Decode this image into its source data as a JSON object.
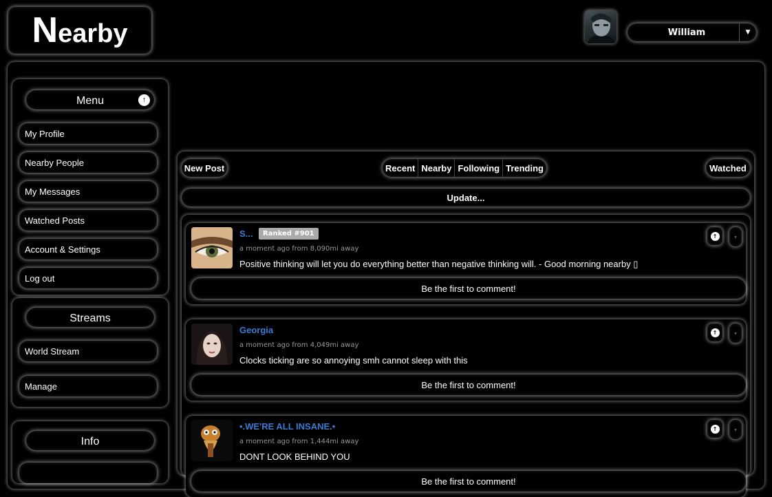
{
  "logo": {
    "initial": "N",
    "rest": "earby"
  },
  "user": {
    "name": "William",
    "caret": "▼"
  },
  "sidebar": {
    "menu": {
      "title": "Menu",
      "items": [
        {
          "label": "My Profile"
        },
        {
          "label": "Nearby People"
        },
        {
          "label": "My Messages"
        },
        {
          "label": "Watched Posts"
        },
        {
          "label": "Account & Settings"
        },
        {
          "label": "Log out"
        }
      ]
    },
    "streams": {
      "title": "Streams",
      "items": [
        {
          "label": "World Stream"
        },
        {
          "label": "Manage"
        }
      ]
    },
    "info": {
      "title": "Info"
    }
  },
  "feed": {
    "new_post": "New Post",
    "tabs": [
      "Recent",
      "Nearby",
      "Following",
      "Trending"
    ],
    "watched": "Watched",
    "update": "Update...",
    "posts": [
      {
        "author": "S...",
        "rank": "Ranked #901",
        "meta": "a moment ago from 8,090mi away",
        "body": "Positive thinking will let you do everything better than negative thinking will. - Good morning nearby ▯",
        "comment": "Be the first to comment!"
      },
      {
        "author": "Georgia",
        "meta": "a moment ago from 4,049mi away",
        "body": "Clocks ticking are so annoying smh cannot sleep with this",
        "comment": "Be the first to comment!"
      },
      {
        "author": "•.WE'RE ALL INSANE.•",
        "meta": "a moment ago from 1,444mi away",
        "body": "DONT LOOK BEHIND YOU",
        "comment": "Be the first to comment!"
      }
    ]
  },
  "icons": {
    "arrow_up": "up-arrow-icon",
    "vote_down": "chevron-down-icon"
  }
}
